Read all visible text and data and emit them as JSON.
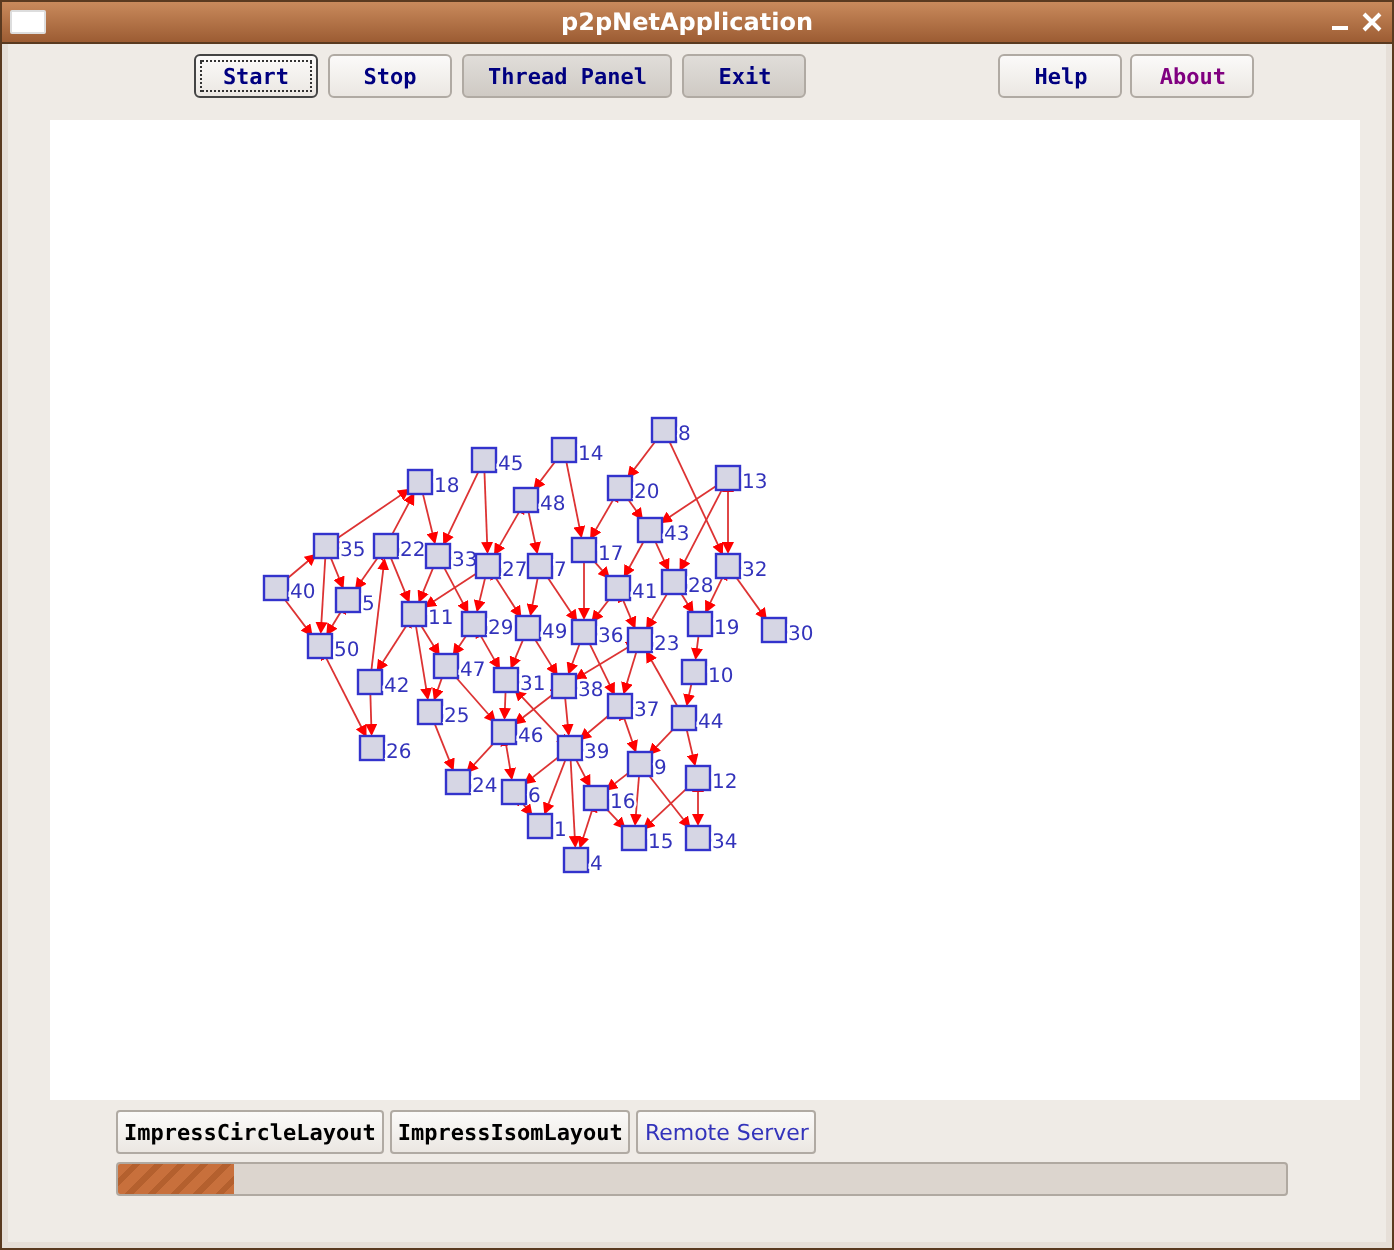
{
  "window": {
    "title": "p2pNetApplication"
  },
  "toolbar": {
    "left": [
      {
        "label": "Start",
        "focused": true,
        "shaded": false
      },
      {
        "label": "Stop",
        "focused": false,
        "shaded": false
      },
      {
        "label": "Thread Panel",
        "focused": false,
        "shaded": true
      },
      {
        "label": "Exit",
        "focused": false,
        "shaded": true
      }
    ],
    "right": [
      {
        "label": "Help",
        "color": "#000080"
      },
      {
        "label": "About",
        "color": "#800080"
      }
    ]
  },
  "graph": {
    "nodes": [
      {
        "label": "40"
      },
      {
        "label": "35"
      },
      {
        "label": "22"
      },
      {
        "label": "18"
      },
      {
        "label": "45"
      },
      {
        "label": "14"
      },
      {
        "label": "8"
      },
      {
        "label": "20"
      },
      {
        "label": "13"
      },
      {
        "label": "48"
      },
      {
        "label": "33"
      },
      {
        "label": "27"
      },
      {
        "label": "7"
      },
      {
        "label": "17"
      },
      {
        "label": "43"
      },
      {
        "label": "28"
      },
      {
        "label": "32"
      },
      {
        "label": "41"
      },
      {
        "label": "5"
      },
      {
        "label": "11"
      },
      {
        "label": "29"
      },
      {
        "label": "49"
      },
      {
        "label": "36"
      },
      {
        "label": "23"
      },
      {
        "label": "19"
      },
      {
        "label": "30"
      },
      {
        "label": "50"
      },
      {
        "label": "47"
      },
      {
        "label": "31"
      },
      {
        "label": "38"
      },
      {
        "label": "10"
      },
      {
        "label": "37"
      },
      {
        "label": "44"
      },
      {
        "label": "42"
      },
      {
        "label": "25"
      },
      {
        "label": "46"
      },
      {
        "label": "39"
      },
      {
        "label": "9"
      },
      {
        "label": "26"
      },
      {
        "label": "12"
      },
      {
        "label": "24"
      },
      {
        "label": "6"
      },
      {
        "label": "16"
      },
      {
        "label": "1"
      },
      {
        "label": "15"
      },
      {
        "label": "34"
      },
      {
        "label": "4"
      }
    ]
  },
  "bottom_buttons": [
    {
      "label": "ImpressCircleLayout",
      "kind": "mono"
    },
    {
      "label": "ImpressIsomLayout",
      "kind": "mono"
    },
    {
      "label": "Remote Server",
      "kind": "plain"
    }
  ],
  "progress": {
    "level": 0.1
  }
}
